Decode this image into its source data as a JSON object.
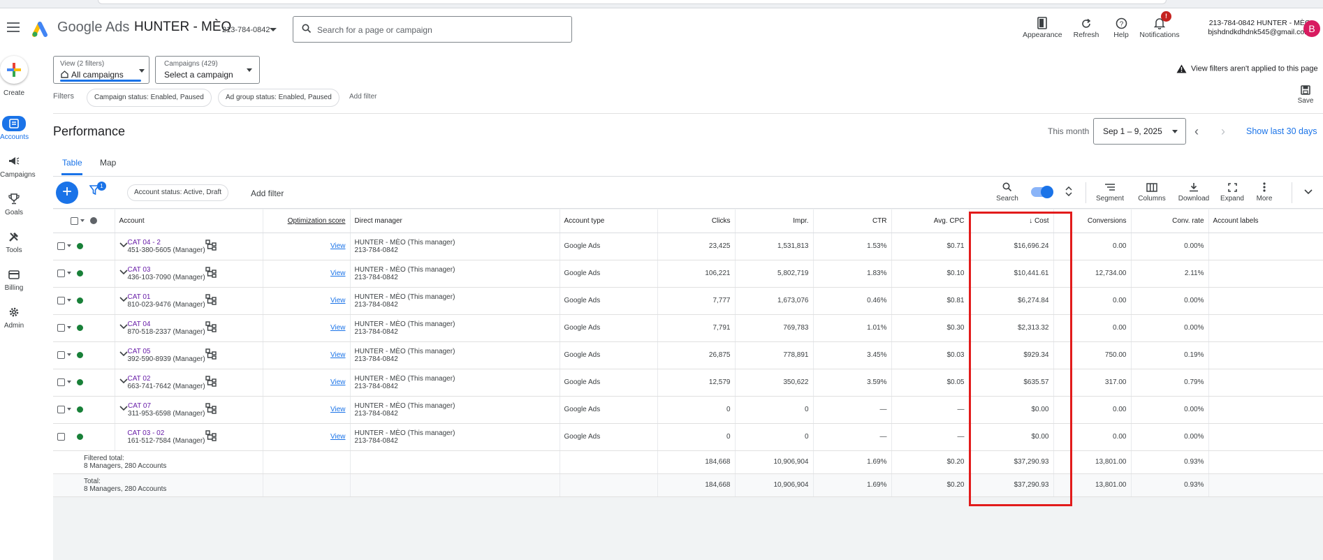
{
  "header": {
    "logo_text": "Google Ads",
    "account_name": "HUNTER - MÈO",
    "account_id": "213-784-0842",
    "search_placeholder": "Search for a page or campaign",
    "tools": [
      {
        "label": "Appearance",
        "icon": "appearance-icon"
      },
      {
        "label": "Refresh",
        "icon": "refresh-icon"
      },
      {
        "label": "Help",
        "icon": "help-icon"
      },
      {
        "label": "Notifications",
        "icon": "bell-icon",
        "badge": "!"
      }
    ],
    "user_line1": "213-784-0842 HUNTER - MÈO",
    "user_line2": "bjshdndkdhdnk545@gmail.com",
    "avatar_letter": "B"
  },
  "leftnav": {
    "create_label": "Create",
    "items": [
      {
        "label": "Accounts",
        "icon": "accounts-icon",
        "active": true
      },
      {
        "label": "Campaigns",
        "icon": "megaphone-icon"
      },
      {
        "label": "Goals",
        "icon": "trophy-icon"
      },
      {
        "label": "Tools",
        "icon": "tools-icon"
      },
      {
        "label": "Billing",
        "icon": "card-icon"
      },
      {
        "label": "Admin",
        "icon": "gear-icon"
      }
    ]
  },
  "filterbar": {
    "view_label": "View (2 filters)",
    "view_value": "All campaigns",
    "campaigns_label": "Campaigns (429)",
    "campaigns_value": "Select a campaign",
    "view_filters_note": "View filters aren't applied to this page",
    "save_label": "Save",
    "filters_label": "Filters",
    "chips": [
      "Campaign status: Enabled, Paused",
      "Ad group status: Enabled, Paused"
    ],
    "add_filter": "Add filter"
  },
  "performance": {
    "title": "Performance",
    "period_label": "This month",
    "date_range": "Sep 1 – 9, 2025",
    "show_last": "Show last 30 days",
    "tabs": [
      "Table",
      "Map"
    ]
  },
  "toolbar": {
    "filter_badge": "1",
    "status_chip": "Account status: Active, Draft",
    "add_filter": "Add filter",
    "tools": [
      "Search",
      "Segment",
      "Columns",
      "Download",
      "Expand",
      "More"
    ]
  },
  "table": {
    "columns": [
      "Account",
      "Optimization score",
      "Direct manager",
      "Account type",
      "Clicks",
      "Impr.",
      "CTR",
      "Avg. CPC",
      "Cost",
      "Conversions",
      "Conv. rate",
      "Account labels"
    ],
    "sorted_column": "Cost",
    "rows": [
      {
        "name": "CAT 04 - 2",
        "sub": "451-380-5605 (Manager)",
        "opt": "View",
        "mgr1": "HUNTER - MÈO (This manager)",
        "mgr2": "213-784-0842",
        "type": "Google Ads",
        "clicks": "23,425",
        "impr": "1,531,813",
        "ctr": "1.53%",
        "cpc": "$0.71",
        "cost": "$16,696.24",
        "conv": "0.00",
        "convrate": "0.00%"
      },
      {
        "name": "CAT 03",
        "sub": "436-103-7090 (Manager)",
        "opt": "View",
        "mgr1": "HUNTER - MÈO (This manager)",
        "mgr2": "213-784-0842",
        "type": "Google Ads",
        "clicks": "106,221",
        "impr": "5,802,719",
        "ctr": "1.83%",
        "cpc": "$0.10",
        "cost": "$10,441.61",
        "conv": "12,734.00",
        "convrate": "2.11%"
      },
      {
        "name": "CAT 01",
        "sub": "810-023-9476 (Manager)",
        "opt": "View",
        "mgr1": "HUNTER - MÈO (This manager)",
        "mgr2": "213-784-0842",
        "type": "Google Ads",
        "clicks": "7,777",
        "impr": "1,673,076",
        "ctr": "0.46%",
        "cpc": "$0.81",
        "cost": "$6,274.84",
        "conv": "0.00",
        "convrate": "0.00%"
      },
      {
        "name": "CAT 04",
        "sub": "870-518-2337 (Manager)",
        "opt": "View",
        "mgr1": "HUNTER - MÈO (This manager)",
        "mgr2": "213-784-0842",
        "type": "Google Ads",
        "clicks": "7,791",
        "impr": "769,783",
        "ctr": "1.01%",
        "cpc": "$0.30",
        "cost": "$2,313.32",
        "conv": "0.00",
        "convrate": "0.00%"
      },
      {
        "name": "CAT 05",
        "sub": "392-590-8939 (Manager)",
        "opt": "View",
        "mgr1": "HUNTER - MÈO (This manager)",
        "mgr2": "213-784-0842",
        "type": "Google Ads",
        "clicks": "26,875",
        "impr": "778,891",
        "ctr": "3.45%",
        "cpc": "$0.03",
        "cost": "$929.34",
        "conv": "750.00",
        "convrate": "0.19%"
      },
      {
        "name": "CAT 02",
        "sub": "663-741-7642 (Manager)",
        "opt": "View",
        "mgr1": "HUNTER - MÈO (This manager)",
        "mgr2": "213-784-0842",
        "type": "Google Ads",
        "clicks": "12,579",
        "impr": "350,622",
        "ctr": "3.59%",
        "cpc": "$0.05",
        "cost": "$635.57",
        "conv": "317.00",
        "convrate": "0.79%"
      },
      {
        "name": "CAT 07",
        "sub": "311-953-6598 (Manager)",
        "opt": "View",
        "mgr1": "HUNTER - MÈO (This manager)",
        "mgr2": "213-784-0842",
        "type": "Google Ads",
        "clicks": "0",
        "impr": "0",
        "ctr": "—",
        "cpc": "—",
        "cost": "$0.00",
        "conv": "0.00",
        "convrate": "0.00%"
      },
      {
        "name": "CAT 03 - 02",
        "sub": "161-512-7584 (Manager)",
        "opt": "View",
        "mgr1": "HUNTER - MÈO (This manager)",
        "mgr2": "213-784-0842",
        "type": "Google Ads",
        "clicks": "0",
        "impr": "0",
        "ctr": "—",
        "cpc": "—",
        "cost": "$0.00",
        "conv": "0.00",
        "convrate": "0.00%"
      }
    ],
    "totals": [
      {
        "label1": "Filtered total:",
        "label2": "8 Managers, 280 Accounts",
        "clicks": "184,668",
        "impr": "10,906,904",
        "ctr": "1.69%",
        "cpc": "$0.20",
        "cost": "$37,290.93",
        "conv": "13,801.00",
        "convrate": "0.93%"
      },
      {
        "label1": "Total:",
        "label2": "8 Managers, 280 Accounts",
        "clicks": "184,668",
        "impr": "10,906,904",
        "ctr": "1.69%",
        "cpc": "$0.20",
        "cost": "$37,290.93",
        "conv": "13,801.00",
        "convrate": "0.93%"
      }
    ]
  },
  "colors": {
    "accent": "#1a73e8",
    "highlight": "#e21b1b",
    "enabled": "#188038",
    "link": "#681da8"
  }
}
